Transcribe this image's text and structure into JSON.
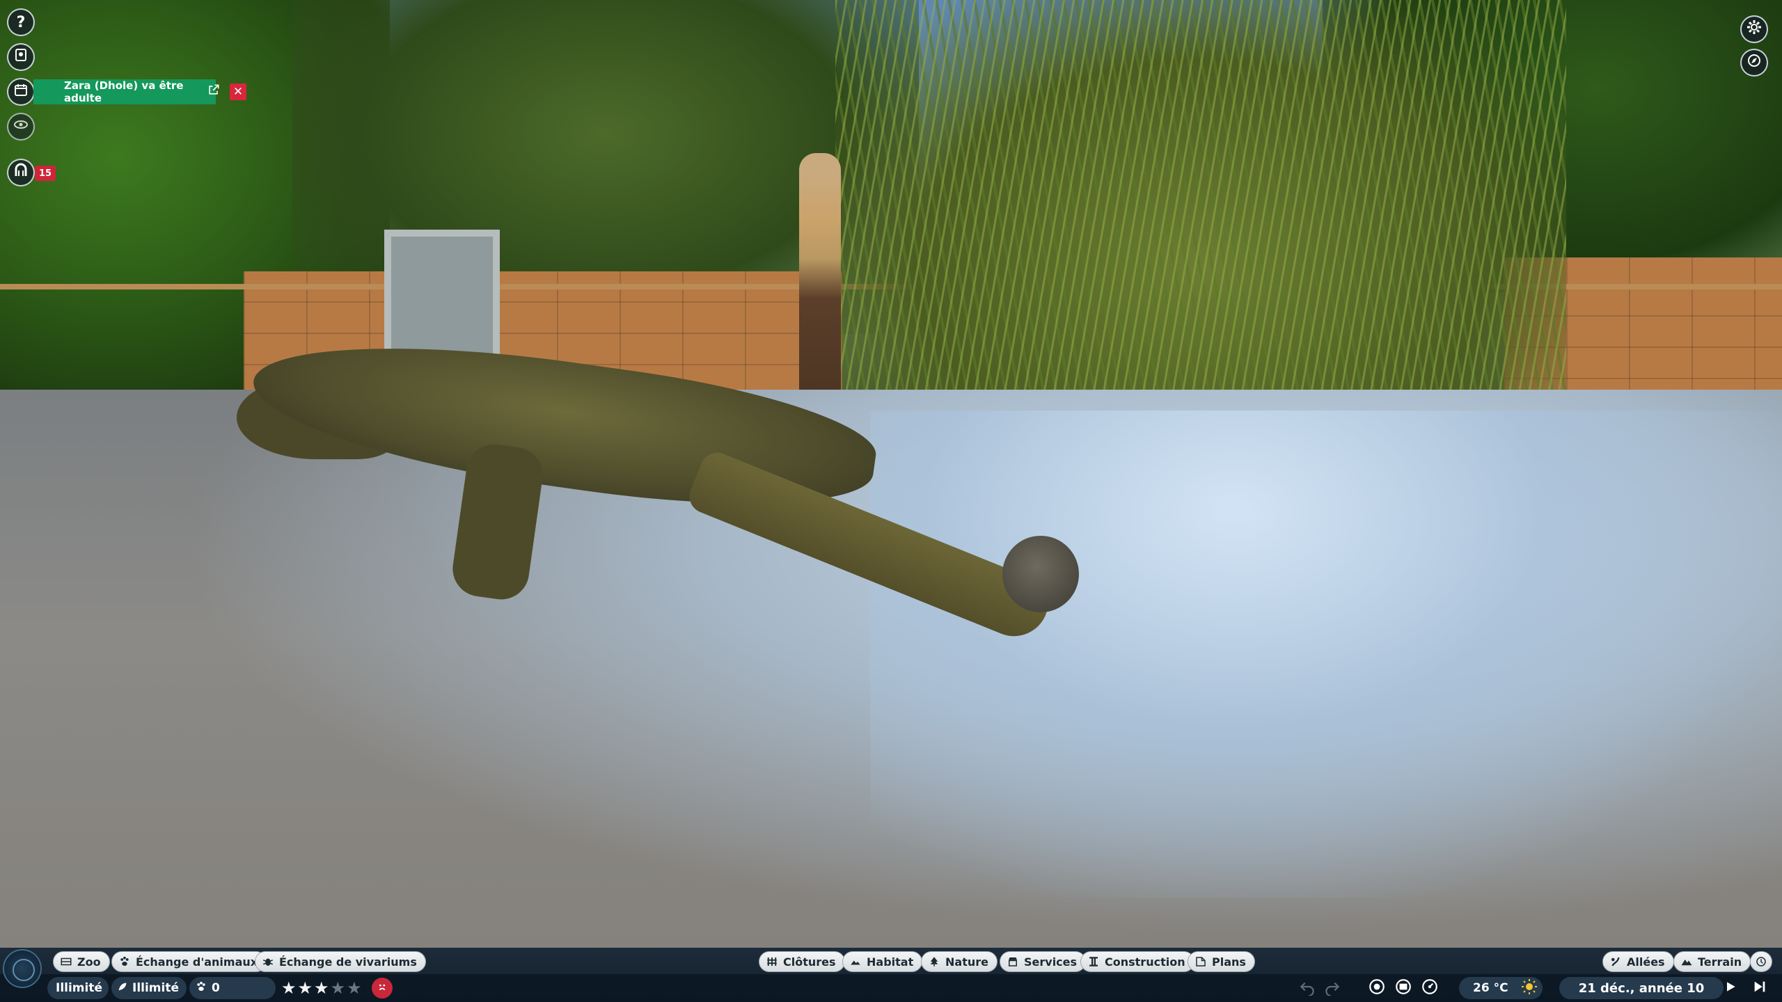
{
  "notification": {
    "text": "Zara (Dhole) va être adulte",
    "close_label": "✕"
  },
  "left_hud": {
    "help_label": "?",
    "guests_badge": "15"
  },
  "toolbar_left": {
    "zoo": "Zoo",
    "animal_exchange": "Échange d'animaux",
    "vivarium_exchange": "Échange de vivariums"
  },
  "toolbar_center": {
    "fences": "Clôtures",
    "habitat": "Habitat",
    "nature": "Nature",
    "services": "Services",
    "construction": "Construction",
    "blueprints": "Plans"
  },
  "toolbar_right": {
    "paths": "Allées",
    "terrain": "Terrain"
  },
  "status": {
    "money": "Illimité",
    "conservation": "Illimité",
    "animals_count": "0",
    "rating_stars": 3,
    "rating_max": 5,
    "temperature": "26 °C",
    "date": "21 déc., année 10"
  },
  "colors": {
    "notification_bg": "#14985b",
    "close_bg": "#d9263a",
    "badge_bg": "#d02538",
    "bar_bg": "#14283a"
  }
}
